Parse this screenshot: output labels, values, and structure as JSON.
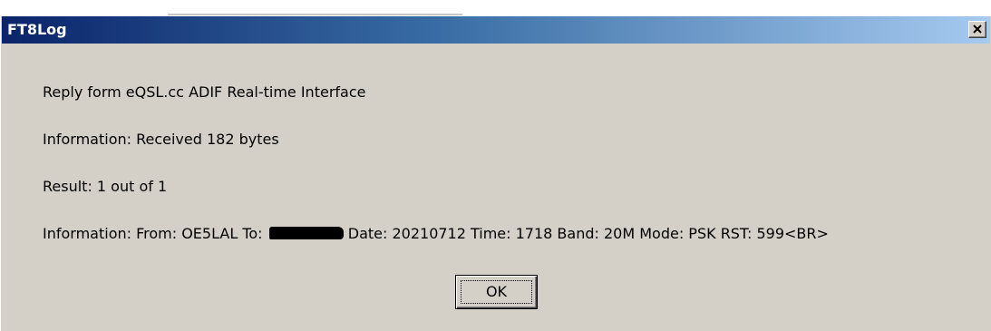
{
  "window": {
    "title": "FT8Log",
    "close_icon": "close-icon"
  },
  "message": {
    "line1": "Reply form eQSL.cc ADIF Real-time Interface",
    "line2": "Information: Received 182 bytes",
    "line3": "Result: 1 out of 1",
    "line4_prefix": "Information: From: OE5LAL To:",
    "line4_suffix": "Date: 20210712 Time: 1718 Band: 20M Mode: PSK RST: 599<BR>"
  },
  "buttons": {
    "ok_label": "OK"
  },
  "colors": {
    "titlebar_start": "#0a246a",
    "titlebar_end": "#a6caf0",
    "dialog_bg": "#d4d0c8"
  }
}
